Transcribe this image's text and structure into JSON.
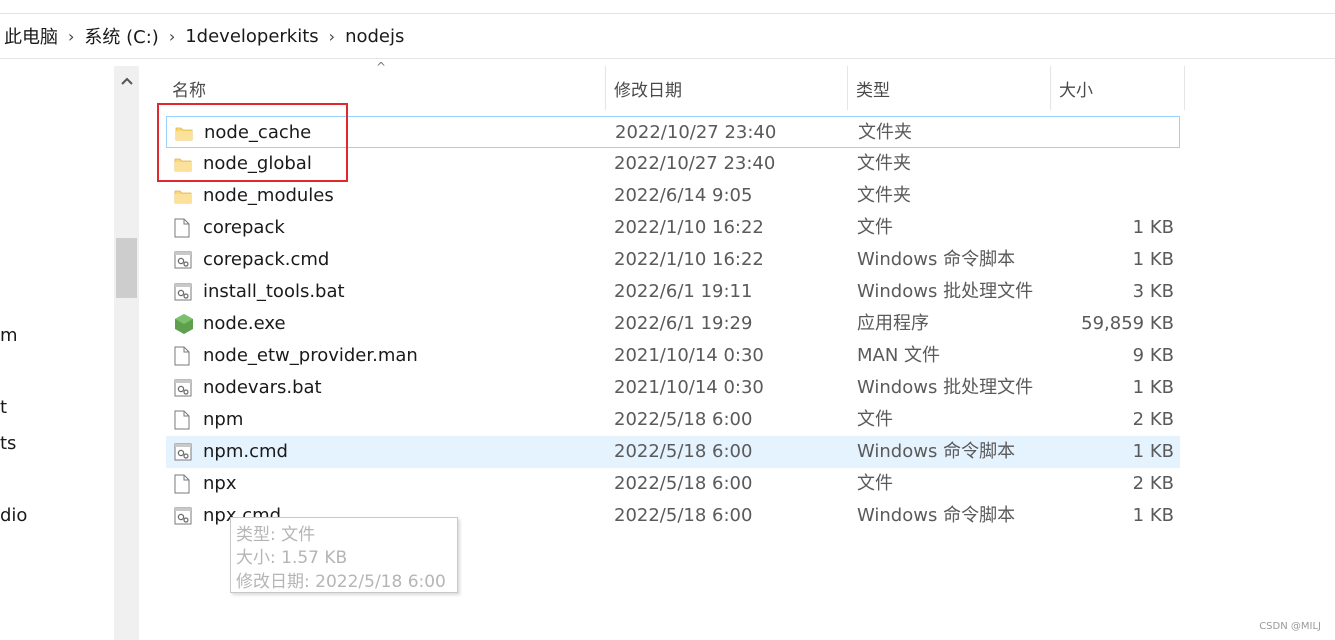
{
  "breadcrumb": [
    {
      "label": "此电脑"
    },
    {
      "label": "系统 (C:)"
    },
    {
      "label": "1developerkits"
    },
    {
      "label": "nodejs"
    }
  ],
  "left_nav": [
    {
      "label": "m"
    },
    {
      "label": "t"
    },
    {
      "label": "ts"
    },
    {
      "label": "dio"
    }
  ],
  "columns": {
    "name": "名称",
    "date": "修改日期",
    "type": "类型",
    "size": "大小"
  },
  "files": [
    {
      "name": "node_cache",
      "date": "2022/10/27 23:40",
      "type": "文件夹",
      "size": "",
      "icon": "folder-icon"
    },
    {
      "name": "node_global",
      "date": "2022/10/27 23:40",
      "type": "文件夹",
      "size": "",
      "icon": "folder-icon"
    },
    {
      "name": "node_modules",
      "date": "2022/6/14 9:05",
      "type": "文件夹",
      "size": "",
      "icon": "folder-icon"
    },
    {
      "name": "corepack",
      "date": "2022/1/10 16:22",
      "type": "文件",
      "size": "1 KB",
      "icon": "file-icon"
    },
    {
      "name": "corepack.cmd",
      "date": "2022/1/10 16:22",
      "type": "Windows 命令脚本",
      "size": "1 KB",
      "icon": "script-icon"
    },
    {
      "name": "install_tools.bat",
      "date": "2022/6/1 19:11",
      "type": "Windows 批处理文件",
      "size": "3 KB",
      "icon": "script-icon"
    },
    {
      "name": "node.exe",
      "date": "2022/6/1 19:29",
      "type": "应用程序",
      "size": "59,859 KB",
      "icon": "nodejs-icon"
    },
    {
      "name": "node_etw_provider.man",
      "date": "2021/10/14 0:30",
      "type": "MAN 文件",
      "size": "9 KB",
      "icon": "file-icon"
    },
    {
      "name": "nodevars.bat",
      "date": "2021/10/14 0:30",
      "type": "Windows 批处理文件",
      "size": "1 KB",
      "icon": "script-icon"
    },
    {
      "name": "npm",
      "date": "2022/5/18 6:00",
      "type": "文件",
      "size": "2 KB",
      "icon": "file-icon"
    },
    {
      "name": "npm.cmd",
      "date": "2022/5/18 6:00",
      "type": "Windows 命令脚本",
      "size": "1 KB",
      "icon": "script-icon"
    },
    {
      "name": "npx",
      "date": "2022/5/18 6:00",
      "type": "文件",
      "size": "2 KB",
      "icon": "file-icon"
    },
    {
      "name": "npx.cmd",
      "date": "2022/5/18 6:00",
      "type": "Windows 命令脚本",
      "size": "1 KB",
      "icon": "script-icon"
    }
  ],
  "tooltip": {
    "type_line": "类型: 文件",
    "size_line": "大小: 1.57 KB",
    "date_line": "修改日期: 2022/5/18 6:00"
  },
  "watermark": "CSDN @MILJ",
  "colors": {
    "annotation_red": "#e0282e",
    "hover_bg": "#e5f3ff",
    "focus_border": "#99d1ff",
    "folder_yellow": "#f8d775",
    "node_green": "#5fa04e"
  }
}
